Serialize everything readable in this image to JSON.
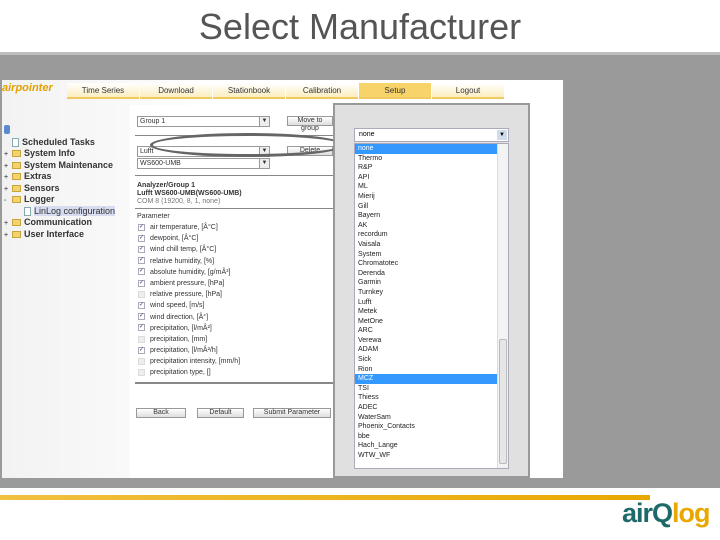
{
  "slide": {
    "title": "Select Manufacturer",
    "brand": "airQlog"
  },
  "app": {
    "logo": "airpointer",
    "tabs": [
      "Time Series",
      "Download",
      "Stationbook",
      "Calibration",
      "Setup",
      "Logout"
    ],
    "tree": [
      {
        "label": "Scheduled Tasks",
        "icon": "file-icon",
        "pm": ""
      },
      {
        "label": "System Info",
        "icon": "folder-icon",
        "pm": "+"
      },
      {
        "label": "System Maintenance",
        "icon": "folder-icon",
        "pm": "+"
      },
      {
        "label": "Extras",
        "icon": "folder-icon",
        "pm": "+"
      },
      {
        "label": "Sensors",
        "icon": "folder-icon",
        "pm": "+"
      },
      {
        "label": "Logger",
        "icon": "folder-icon",
        "pm": "-"
      },
      {
        "label": "LinLog configuration",
        "icon": "file-icon",
        "pm": ""
      },
      {
        "label": "Communication",
        "icon": "folder-icon",
        "pm": "+"
      },
      {
        "label": "User Interface",
        "icon": "folder-icon",
        "pm": "+"
      }
    ],
    "group_select": "Group 1",
    "move_button": "Move to group",
    "manufacturer_select": "Lufft",
    "model_select": "WS600-UMB",
    "delete_button": "Delete",
    "analyzer_title": "Analyzer/Group 1",
    "analyzer_name": "Lufft WS600-UMB(WS600-UMB)",
    "analyzer_port": "COM 8 (19200, 8, 1, none)",
    "parameter_label": "Parameter",
    "parameters": [
      {
        "label": "air temperature, [Â°C]",
        "checked": true
      },
      {
        "label": "dewpoint, [Â°C]",
        "checked": true
      },
      {
        "label": "wind chill temp, [Â°C]",
        "checked": true
      },
      {
        "label": "relative humidity, [%]",
        "checked": true
      },
      {
        "label": "absolute humidity, [g/mÂ³]",
        "checked": true
      },
      {
        "label": "ambient pressure, [hPa]",
        "checked": true
      },
      {
        "label": "relative pressure, [hPa]",
        "checked": false
      },
      {
        "label": "wind speed, [m/s]",
        "checked": true
      },
      {
        "label": "wind direction, [Â°]",
        "checked": true
      },
      {
        "label": "precipitation, [l/mÂ²]",
        "checked": true
      },
      {
        "label": "precipitation, [mm]",
        "checked": false
      },
      {
        "label": "precipitation, [l/mÂ²/h]",
        "checked": true
      },
      {
        "label": "precipitation intensity, [mm/h]",
        "checked": false
      },
      {
        "label": "precipitation type, []",
        "checked": false
      }
    ],
    "back_button": "Back",
    "default_button": "Default",
    "submit_button": "Submit Parameter"
  },
  "dropdown": {
    "selected": "none",
    "highlighted": "MCZ",
    "options": [
      "none",
      "Thermo",
      "R&P",
      "API",
      "ML",
      "Mierij",
      "Gill",
      "Bayern",
      "AK",
      "recordum",
      "Vaisala",
      "System",
      "Chromatotec",
      "Derenda",
      "Garmin",
      "Turnkey",
      "Lufft",
      "Metek",
      "MetOne",
      "ARC",
      "Verewa",
      "ADAM",
      "Sick",
      "Rion",
      "MCZ",
      "TSI",
      "Thiess",
      "ADEC",
      "WaterSam",
      "Phoenix_Contacts",
      "bbe",
      "Hach_Lange",
      "WTW_WF"
    ]
  }
}
